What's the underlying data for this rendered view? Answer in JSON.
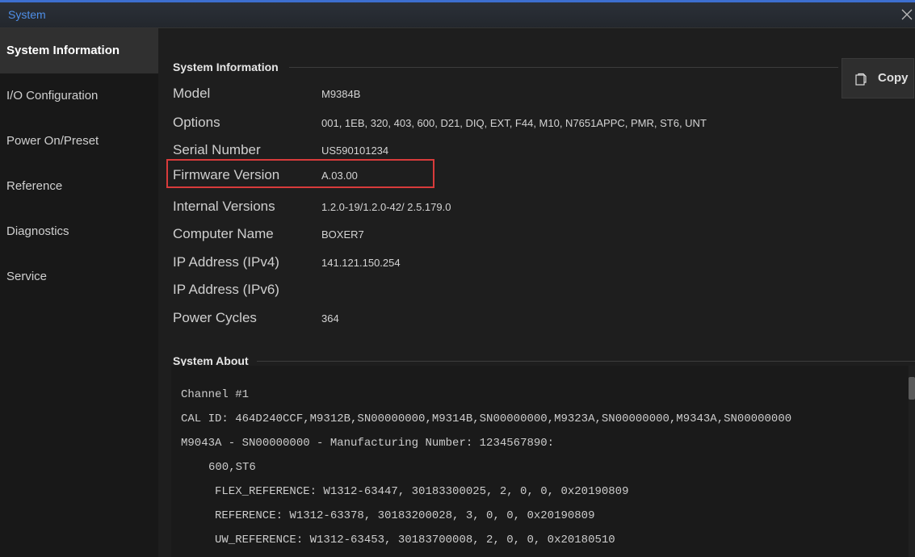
{
  "window": {
    "title": "System"
  },
  "sidebar": {
    "items": [
      {
        "label": "System Information"
      },
      {
        "label": "I/O Configuration"
      },
      {
        "label": "Power On/Preset"
      },
      {
        "label": "Reference"
      },
      {
        "label": "Diagnostics"
      },
      {
        "label": "Service"
      }
    ],
    "active_index": 0
  },
  "system_info": {
    "header": "System Information",
    "copy_label": "Copy",
    "rows": [
      {
        "label": "Model",
        "value": "M9384B"
      },
      {
        "label": "Options",
        "value": "001, 1EB, 320, 403, 600, D21, DIQ, EXT, F44, M10, N7651APPC, PMR, ST6, UNT"
      },
      {
        "label": "Serial Number",
        "value": "US590101234"
      },
      {
        "label": "Firmware Version",
        "value": "A.03.00"
      },
      {
        "label": "Internal Versions",
        "value": "1.2.0-19/1.2.0-42/ 2.5.179.0"
      },
      {
        "label": "Computer Name",
        "value": "BOXER7"
      },
      {
        "label": "IP Address (IPv4)",
        "value": "141.121.150.254"
      },
      {
        "label": "IP Address (IPv6)",
        "value": ""
      },
      {
        "label": "Power Cycles",
        "value": "364"
      }
    ]
  },
  "system_about": {
    "header": "System About",
    "lines": [
      "Channel #1",
      "CAL ID: 464D240CCF,M9312B,SN00000000,M9314B,SN00000000,M9323A,SN00000000,M9343A,SN00000000",
      "M9043A - SN00000000 - Manufacturing Number: 1234567890:",
      "600,ST6",
      "FLEX_REFERENCE: W1312-63447, 30183300025, 2, 0, 0, 0x20190809",
      "REFERENCE: W1312-63378, 30183200028, 3, 0, 0, 0x20190809",
      "UW_REFERENCE: W1312-63453, 30183700008, 2, 0, 0, 0x20180510"
    ]
  },
  "colors": {
    "accent": "#4f8fe8",
    "highlight_border": "#d83b3b",
    "background": "#1e1e1e"
  },
  "icons": {
    "close": "close-icon",
    "copy": "copy-icon"
  }
}
